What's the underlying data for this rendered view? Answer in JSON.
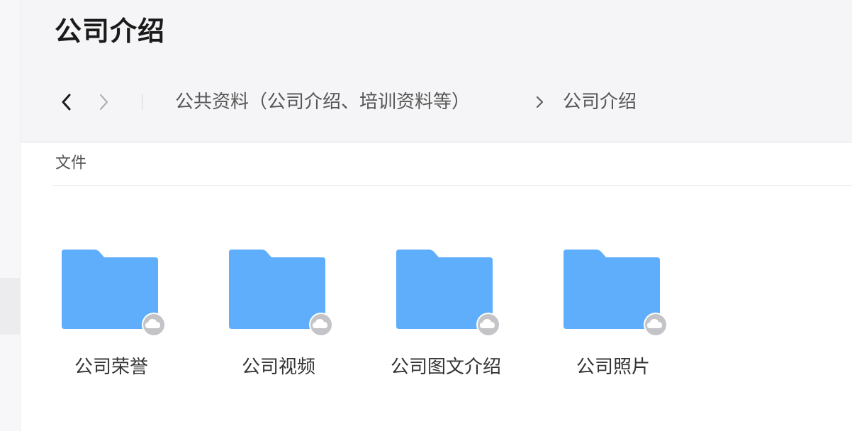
{
  "header": {
    "title": "公司介绍"
  },
  "nav": {
    "back_icon": "chevron-left-icon",
    "forward_icon": "chevron-right-icon"
  },
  "breadcrumb": {
    "items": [
      "公共资料（公司介绍、培训资料等）",
      "公司介绍"
    ],
    "separator_icon": "chevron-right-icon"
  },
  "section": {
    "label": "文件"
  },
  "folders": [
    {
      "name": "公司荣誉",
      "icon": "folder-icon",
      "badge_icon": "cloud-icon"
    },
    {
      "name": "公司视频",
      "icon": "folder-icon",
      "badge_icon": "cloud-icon"
    },
    {
      "name": "公司图文介绍",
      "icon": "folder-icon",
      "badge_icon": "cloud-icon"
    },
    {
      "name": "公司照片",
      "icon": "folder-icon",
      "badge_icon": "cloud-icon"
    }
  ],
  "colors": {
    "folder_fill": "#5eaefc",
    "folder_tab": "#5eaefc",
    "badge_fill": "#c4c4c8",
    "header_bg": "#f5f5f7"
  }
}
